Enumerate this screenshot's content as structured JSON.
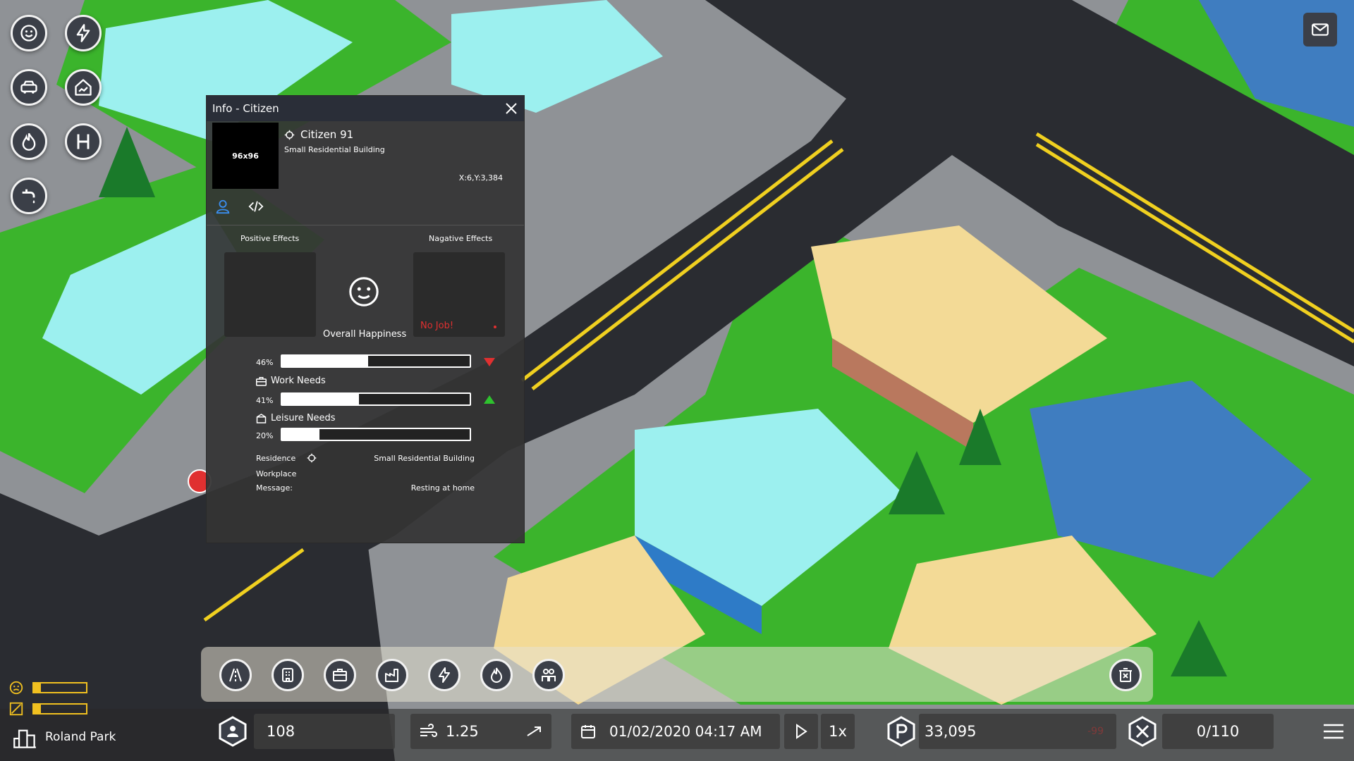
{
  "left_buttons": [
    {
      "name": "happiness-icon"
    },
    {
      "name": "electricity-icon"
    },
    {
      "name": "traffic-icon"
    },
    {
      "name": "land-value-icon"
    },
    {
      "name": "fire-icon"
    },
    {
      "name": "hospital-icon"
    },
    {
      "name": "water-icon"
    }
  ],
  "info_panel": {
    "title": "Info - Citizen",
    "avatar_label": "96x96",
    "citizen_name": "Citizen 91",
    "building": "Small Residential Building",
    "coords": "X:6,Y:3,384",
    "positive_label": "Positive Effects",
    "negative_label": "Nagative Effects",
    "overall_label": "Overall Happiness",
    "negative_effect": "No Job!",
    "bars": [
      {
        "pct_label": "46%",
        "value": 0.46,
        "trend": "down"
      },
      {
        "pct_label": "41%",
        "value": 0.41,
        "trend": "up",
        "label": "Work Needs"
      },
      {
        "pct_label": "20%",
        "value": 0.2,
        "label": "Leisure Needs"
      }
    ],
    "residence_label": "Residence",
    "residence_value": "Small Residential Building",
    "workplace_label": "Workplace",
    "message_label": "Message:",
    "message_value": "Resting at home"
  },
  "toolbar": [
    "road-icon",
    "residential-icon",
    "commercial-icon",
    "industrial-icon",
    "power-icon",
    "fire-service-icon",
    "police-icon"
  ],
  "status": {
    "city_name": "Roland Park",
    "population": "108",
    "speed_value": "1.25",
    "datetime": "01/02/2020 04:17 AM",
    "game_speed": "1x",
    "money": "33,095",
    "money_delta": "-99",
    "capacity": "0/110"
  },
  "colors": {
    "accent": "#3b3f48",
    "negative": "#e03030",
    "positive": "#2ec22e"
  }
}
